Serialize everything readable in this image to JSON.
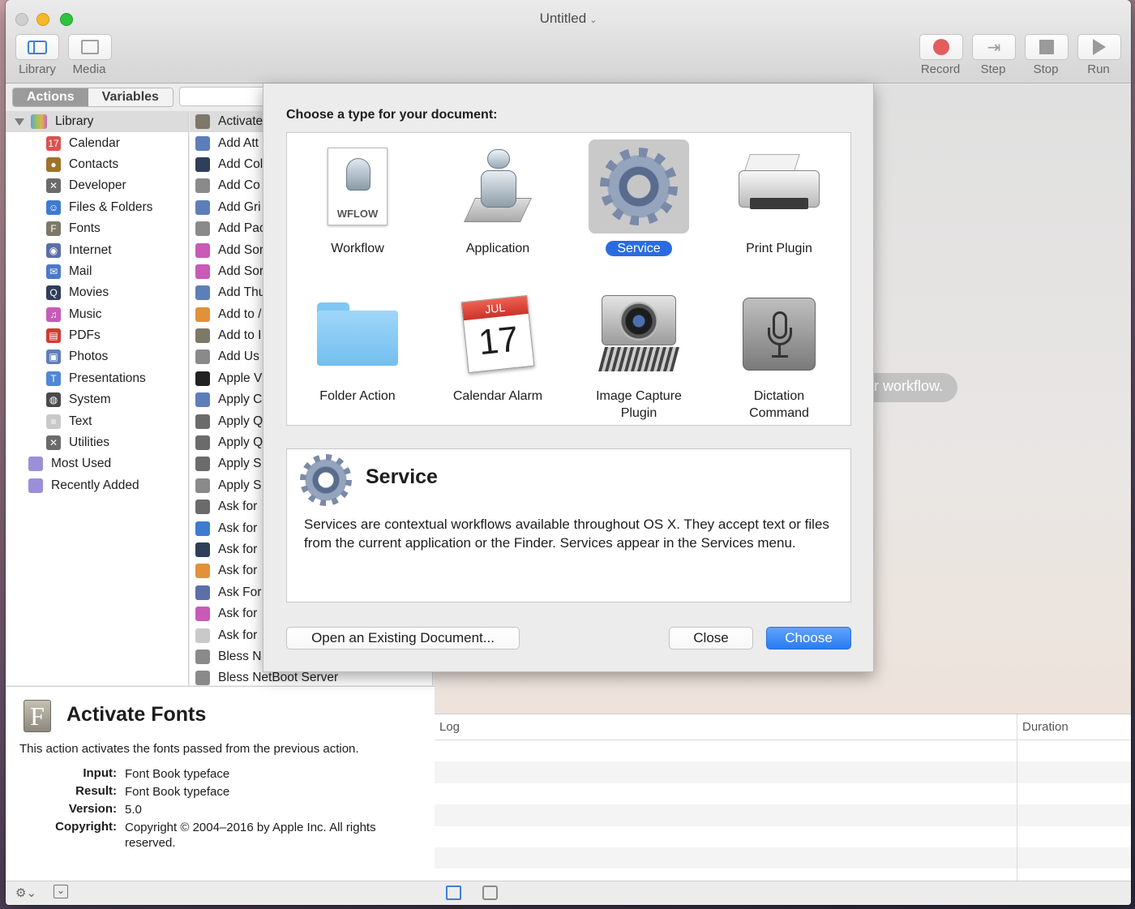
{
  "window": {
    "title": "Untitled",
    "title_chevron": "⌄"
  },
  "toolbar": {
    "left": [
      {
        "label": "Library",
        "icon": "library-icon"
      },
      {
        "label": "Media",
        "icon": "media-icon"
      }
    ],
    "right": [
      {
        "label": "Record",
        "icon": "record-icon"
      },
      {
        "label": "Step",
        "icon": "step-icon"
      },
      {
        "label": "Stop",
        "icon": "stop-icon"
      },
      {
        "label": "Run",
        "icon": "run-icon"
      }
    ],
    "step_glyph": "⇥"
  },
  "tabs": {
    "actions": "Actions",
    "variables": "Variables"
  },
  "library": {
    "root": "Library",
    "items": [
      {
        "label": "Calendar",
        "color": "#d9534f",
        "glyph": "17"
      },
      {
        "label": "Contacts",
        "color": "#a0722a",
        "glyph": "●"
      },
      {
        "label": "Developer",
        "color": "#6b6b6b",
        "glyph": "✕"
      },
      {
        "label": "Files & Folders",
        "color": "#3d7bd1",
        "glyph": "☺"
      },
      {
        "label": "Fonts",
        "color": "#7d7867",
        "glyph": "F"
      },
      {
        "label": "Internet",
        "color": "#5b6fa8",
        "glyph": "◉"
      },
      {
        "label": "Mail",
        "color": "#4b7ac8",
        "glyph": "✉"
      },
      {
        "label": "Movies",
        "color": "#2f3e5a",
        "glyph": "Q"
      },
      {
        "label": "Music",
        "color": "#c85ab8",
        "glyph": "♫"
      },
      {
        "label": "PDFs",
        "color": "#d23b33",
        "glyph": "▤"
      },
      {
        "label": "Photos",
        "color": "#5d7fb9",
        "glyph": "▣"
      },
      {
        "label": "Presentations",
        "color": "#4f86d6",
        "glyph": "T"
      },
      {
        "label": "System",
        "color": "#4a4a4a",
        "glyph": "◍"
      },
      {
        "label": "Text",
        "color": "#c9c9c9",
        "glyph": "≡"
      },
      {
        "label": "Utilities",
        "color": "#6b6b6b",
        "glyph": "✕"
      }
    ],
    "smart": [
      {
        "label": "Most Used"
      },
      {
        "label": "Recently Added"
      }
    ]
  },
  "actions_list": [
    "Activate",
    "Add Att",
    "Add Col",
    "Add Co",
    "Add Gri",
    "Add Pac",
    "Add Sor",
    "Add Sor",
    "Add Thu",
    "Add to /",
    "Add to I",
    "Add Us",
    "Apple V",
    "Apply C",
    "Apply Q",
    "Apply Q",
    "Apply S",
    "Apply S",
    "Ask for",
    "Ask for",
    "Ask for",
    "Ask for",
    "Ask For",
    "Ask for",
    "Ask for",
    "Bless N",
    "Bless NetBoot Server"
  ],
  "description": {
    "icon_letter": "F",
    "title": "Activate Fonts",
    "text": "This action activates the fonts passed from the previous action.",
    "fields": [
      {
        "key": "Input:",
        "value": "Font Book typeface"
      },
      {
        "key": "Result:",
        "value": "Font Book typeface"
      },
      {
        "key": "Version:",
        "value": "5.0"
      },
      {
        "key": "Copyright:",
        "value": "Copyright © 2004–2016 by Apple Inc. All rights reserved."
      }
    ]
  },
  "workflow_hint": "r workflow.",
  "log": {
    "col_log": "Log",
    "col_duration": "Duration"
  },
  "sheet": {
    "heading": "Choose a type for your document:",
    "types": [
      {
        "label": "Workflow",
        "icon": "workflow-document-icon"
      },
      {
        "label": "Application",
        "icon": "automator-robot-icon"
      },
      {
        "label": "Service",
        "icon": "gear-icon",
        "selected": true
      },
      {
        "label": "Print Plugin",
        "icon": "printer-icon"
      },
      {
        "label": "Folder Action",
        "icon": "folder-icon"
      },
      {
        "label": "Calendar Alarm",
        "icon": "calendar-icon"
      },
      {
        "label": "Image Capture Plugin",
        "icon": "camera-icon"
      },
      {
        "label": "Dictation Command",
        "icon": "microphone-icon"
      }
    ],
    "workflow_doc_label": "WFLOW",
    "calendar_month": "JUL",
    "calendar_day": "17",
    "info_title": "Service",
    "info_text": "Services are contextual workflows available throughout OS X. They accept text or files from the current application or the Finder. Services appear in the Services menu.",
    "open_button": "Open an Existing Document...",
    "close_button": "Close",
    "choose_button": "Choose"
  },
  "bottom": {
    "gear": "⚙⌄",
    "collapse": "⌄"
  }
}
